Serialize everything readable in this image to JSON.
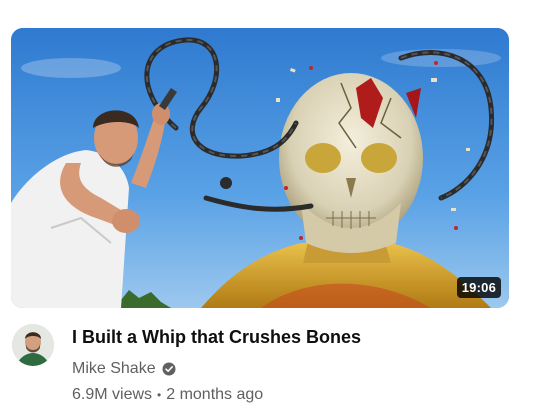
{
  "video": {
    "title": "I Built a Whip that Crushes Bones",
    "duration": "19:06",
    "channel": "Mike Shake",
    "views": "6.9M views",
    "separator": "•",
    "age": "2 months ago"
  },
  "icons": {
    "verified": "verified-check-icon"
  },
  "colors": {
    "title_text": "#0f0f0f",
    "secondary_text": "#606060",
    "duration_bg": "#000000",
    "sky": "#4a8fd6",
    "skull": "#e8e2cc",
    "gold": "#d8a62a"
  }
}
